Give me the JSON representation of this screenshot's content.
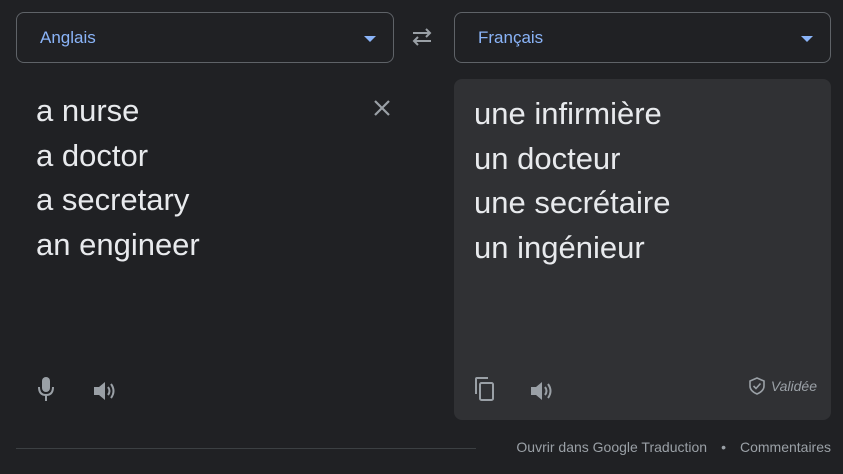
{
  "source": {
    "language": "Anglais",
    "lines": [
      "a nurse",
      "a doctor",
      "a secretary",
      "an engineer"
    ]
  },
  "target": {
    "language": "Français",
    "lines": [
      "une infirmière",
      "un docteur",
      "une secrétaire",
      "un ingénieur"
    ],
    "validated_label": "Validée"
  },
  "icons": {
    "swap": "swap-arrows-icon",
    "clear": "close-icon",
    "mic": "microphone-icon",
    "speaker": "speaker-icon",
    "copy": "copy-icon",
    "shield": "shield-check-icon",
    "caret": "caret-down-icon"
  },
  "footer": {
    "open_link": "Ouvrir dans Google Traduction",
    "separator": "•",
    "feedback_link": "Commentaires"
  },
  "colors": {
    "background": "#202124",
    "panel": "#303134",
    "accent": "#8ab4f8",
    "text": "#e8eaed",
    "muted": "#9aa0a6"
  }
}
